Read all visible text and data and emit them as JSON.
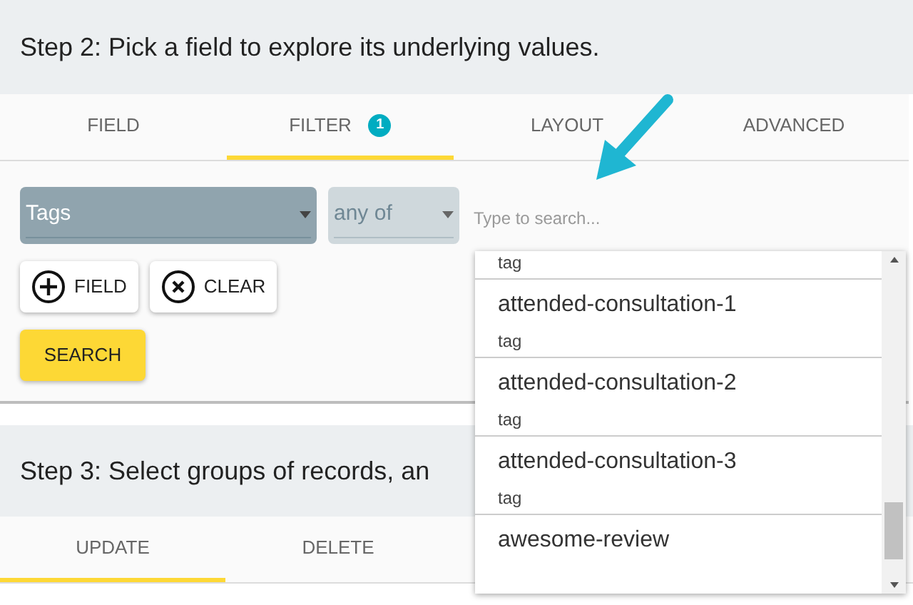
{
  "step2": {
    "title": "Step 2: Pick a field to explore its underlying values.",
    "tabs": [
      {
        "label": "FIELD",
        "selected": false
      },
      {
        "label": "FILTER",
        "selected": true,
        "badge": "1"
      },
      {
        "label": "LAYOUT",
        "selected": false
      },
      {
        "label": "ADVANCED",
        "selected": false
      }
    ],
    "field_select": {
      "value": "Tags"
    },
    "operator_select": {
      "value": "any of",
      "disabled": true
    },
    "search": {
      "placeholder": "Type to search..."
    },
    "buttons": [
      {
        "kind": "add",
        "label": "FIELD"
      },
      {
        "kind": "clear",
        "label": "CLEAR"
      }
    ],
    "search_button": "SEARCH"
  },
  "step3": {
    "title": "Step 3: Select groups of records, an",
    "tabs": [
      {
        "label": "UPDATE",
        "selected": true
      },
      {
        "label": "DELETE",
        "selected": false
      }
    ]
  },
  "dropdown": {
    "items": [
      {
        "type": "tag"
      },
      {
        "name": "attended-consultation-1",
        "type": "tag"
      },
      {
        "name": "attended-consultation-2",
        "type": "tag"
      },
      {
        "name": "attended-consultation-3",
        "type": "tag"
      },
      {
        "name": "awesome-review"
      }
    ]
  }
}
